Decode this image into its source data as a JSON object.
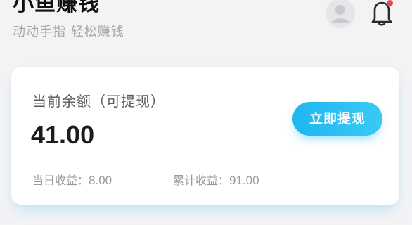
{
  "header": {
    "title": "小鱼赚钱",
    "subtitle": "动动手指 轻松赚钱",
    "avatar_icon": "user-avatar-icon",
    "bell_icon": "notification-bell-icon",
    "bell_badge_color": "#f0454a"
  },
  "balance_card": {
    "label": "当前余额（可提现）",
    "amount": "41.00",
    "withdraw_label": "立即提现",
    "accent_color": "#1fb6f2",
    "today_label": "当日收益：",
    "today_value": "8.00",
    "total_label": "累计收益：",
    "total_value": "91.00"
  }
}
